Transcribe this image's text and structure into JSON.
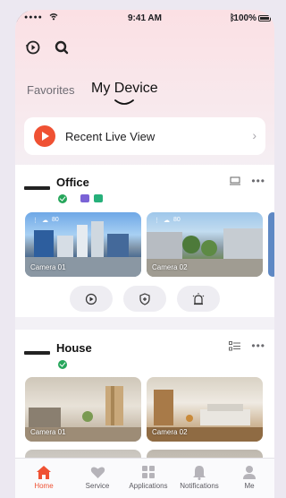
{
  "status_bar": {
    "signal": "●●●●",
    "time": "9:41 AM",
    "battery": "100%"
  },
  "header": {
    "tabs": [
      {
        "label": "Favorites"
      },
      {
        "label": "My Device"
      }
    ]
  },
  "recent_live_view": {
    "label": "Recent Live View"
  },
  "groups": [
    {
      "name": "Office",
      "cameras": [
        {
          "label": "Camera 01",
          "signal": "80"
        },
        {
          "label": "Camera 02",
          "signal": "80"
        }
      ]
    },
    {
      "name": "House",
      "cameras": [
        {
          "label": "Camera 01"
        },
        {
          "label": "Camera 02"
        }
      ]
    }
  ],
  "bottom_nav": [
    {
      "label": "Home",
      "icon": "home-icon",
      "active": true
    },
    {
      "label": "Service",
      "icon": "heart-icon"
    },
    {
      "label": "Applications",
      "icon": "grid-icon"
    },
    {
      "label": "Notifications",
      "icon": "bell-icon"
    },
    {
      "label": "Me",
      "icon": "person-icon"
    }
  ],
  "colors": {
    "accent": "#ef5133",
    "online": "#26a65b"
  }
}
